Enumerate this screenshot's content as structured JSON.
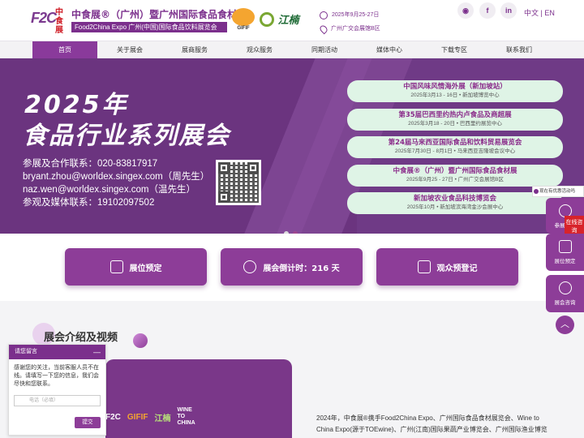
{
  "header": {
    "logo_letters": "F2C",
    "logo_cn": "中食展",
    "title_main": "中食展®（广州）暨广州国际食品食材展",
    "title_sub": "Food2China Expo  广州(中国)国际食品饮料展览会",
    "partner_logo_1": "GIFIF",
    "partner_logo_2": "江楠",
    "date": "2025年9月25-27日",
    "venue": "广州广交会展馆B区",
    "social": [
      "wechat-icon",
      "facebook-icon",
      "linkedin-icon"
    ],
    "lang": "中文 | EN"
  },
  "nav": {
    "items": [
      "首页",
      "关于展会",
      "展商服务",
      "观众服务",
      "同期活动",
      "媒体中心",
      "下载专区",
      "联系我们"
    ],
    "active_index": 0
  },
  "banner": {
    "year_title": "2025年",
    "series_title": "食品行业系列展会",
    "contacts": [
      "参展及合作联系：020-83817917",
      "bryant.zhou@worldex.singex.com（周先生）",
      "naz.wen@worldex.singex.com（温先生）",
      "参观及媒体联系：19102097502"
    ],
    "events": [
      {
        "title": "中国风味风情海外展（新加坡站）",
        "sub": "2025年3月13 - 16日 • 新加坡博览中心"
      },
      {
        "title": "第35届巴西里约热内卢食品及商超展",
        "sub": "2025年3月18 - 20日 • 巴西里约展览中心"
      },
      {
        "title": "第24届马来西亚国际食品和饮料贸易展览会",
        "sub": "2025年7月30日 - 8月1日 • 马来西亚吉隆坡会议中心"
      },
      {
        "title": "中食展®（广州）暨广州国际食品食材展",
        "sub": "2025年9月25 - 27日 • 广州广交会展馆B区"
      },
      {
        "title": "新加坡农业食品科技博览会",
        "sub": "2025年10月 • 新加坡滨海湾金沙会展中心"
      }
    ],
    "slide_count": 2,
    "active_slide": 0
  },
  "actions": {
    "booking": "展位预定",
    "countdown": "展会倒计时：216 天",
    "register": "观众预登记"
  },
  "section": {
    "title": "展会介绍及视频",
    "video_logos": [
      "F2C",
      "GIFIF",
      "江楠",
      "WINE TO CHINA"
    ],
    "intro": "2024年，中食展®携手Food2China Expo、广州国际食品食材展览会、Wine to China Expo(源于TOEwine)、广州(江南)国际果蔬产业博览会、广州国际渔业博览"
  },
  "floating": {
    "top_notice": "现在有优惠活动吗",
    "exhibit_consult": "参展咨询",
    "online_consult": "在线咨询",
    "booking": "展位预定",
    "exhibition_consult": "展会咨询",
    "to_top": "︿"
  },
  "chat": {
    "header": "请您留言",
    "close": "—",
    "message": "感谢您的关注，当前客服人员不在线。请填写一下您的信息，我们会尽快和您联系。",
    "phone_placeholder": "电话（必填）",
    "submit": "提交"
  }
}
